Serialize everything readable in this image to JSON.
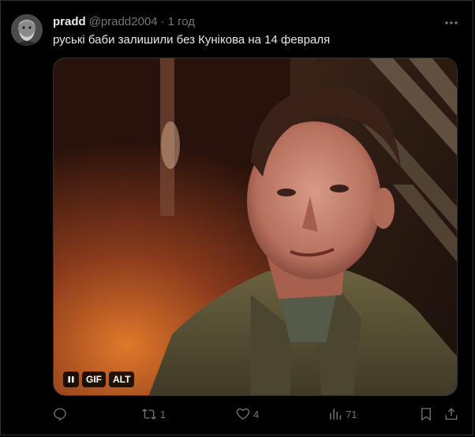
{
  "tweet": {
    "author_name": "pradd",
    "handle": "@pradd2004",
    "separator": "·",
    "time": "1 год",
    "text": "руські баби залишили без Кунікова на 14 февраля"
  },
  "media": {
    "type": "gif",
    "badges": {
      "gif_label": "GIF",
      "alt_label": "ALT"
    }
  },
  "actions": {
    "replies": "",
    "retweets": "1",
    "likes": "4",
    "views": "71"
  },
  "colors": {
    "background": "#000000",
    "text_primary": "#e7e9ea",
    "text_secondary": "#71767b",
    "border": "#2f3336"
  },
  "icons": [
    "more-icon",
    "reply-icon",
    "retweet-icon",
    "like-icon",
    "views-icon",
    "bookmark-icon",
    "share-icon",
    "pause-icon"
  ]
}
